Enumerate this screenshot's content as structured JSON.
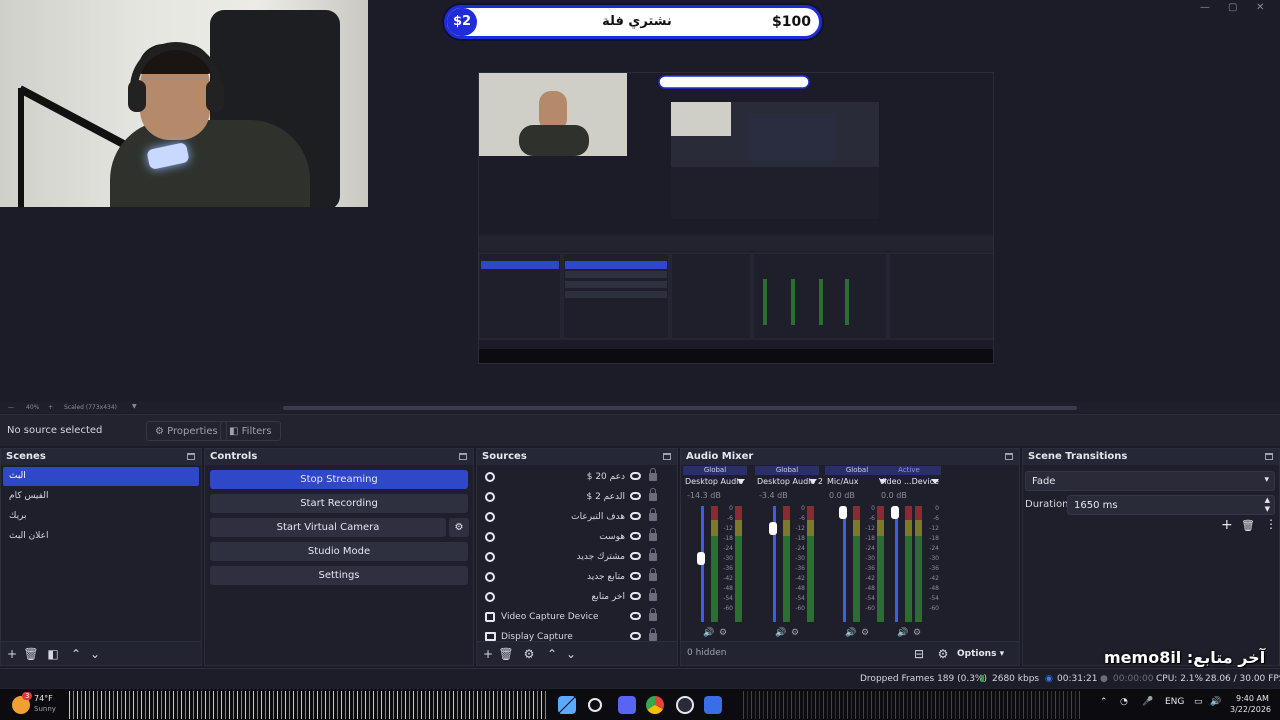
{
  "preview": {
    "donation": {
      "count": "$2",
      "title": "نشتري فلة",
      "goal": "$100"
    },
    "zoom": "40%",
    "scale_mode": "Scaled (773x434)"
  },
  "source_toolbar": {
    "no_source": "No source selected",
    "properties": "Properties",
    "filters": "Filters"
  },
  "scenes": {
    "title": "Scenes",
    "items": [
      {
        "label": "البث",
        "active": true
      },
      {
        "label": "الفيس كام",
        "active": false
      },
      {
        "label": "بريك",
        "active": false
      },
      {
        "label": "اعلان البث",
        "active": false
      }
    ]
  },
  "controls": {
    "title": "Controls",
    "stop_streaming": "Stop Streaming",
    "start_recording": "Start Recording",
    "start_virtual_camera": "Start Virtual Camera",
    "studio_mode": "Studio Mode",
    "settings": "Settings"
  },
  "sources": {
    "title": "Sources",
    "items": [
      {
        "label": "دعم 20 $",
        "icon": "globe-icon",
        "rtl": true
      },
      {
        "label": "الدعم 2 $",
        "icon": "globe-icon",
        "rtl": true
      },
      {
        "label": "هدف التبرعات",
        "icon": "globe-icon",
        "rtl": true
      },
      {
        "label": "هوست",
        "icon": "globe-icon",
        "rtl": true
      },
      {
        "label": "مشترك جديد",
        "icon": "globe-icon",
        "rtl": true
      },
      {
        "label": "متابع جديد",
        "icon": "globe-icon",
        "rtl": true
      },
      {
        "label": "اخر متابع",
        "icon": "globe-icon",
        "rtl": true
      },
      {
        "label": "Video Capture Device",
        "icon": "camera-icon",
        "rtl": false
      },
      {
        "label": "Display Capture",
        "icon": "monitor-icon",
        "rtl": false
      }
    ]
  },
  "audio_mixer": {
    "title": "Audio Mixer",
    "hidden": "0 hidden",
    "options": "Options",
    "channels": [
      {
        "tag": "Global",
        "name": "Desktop Audio",
        "db": "-14.3 dB",
        "level": 0.46
      },
      {
        "tag": "Global",
        "name": "Desktop Audio 2",
        "db": "-3.4 dB",
        "level": 0.8
      },
      {
        "tag": "Global",
        "name": "Mic/Aux",
        "db": "0.0 dB",
        "level": 1.0
      },
      {
        "tag": "Active",
        "name": "Video ...Device",
        "db": "0.0 dB",
        "level": 1.0
      }
    ],
    "scale": [
      "0",
      "-6",
      "-12",
      "-18",
      "-24",
      "-30",
      "-36",
      "-42",
      "-48",
      "-54",
      "-60"
    ]
  },
  "scene_transitions": {
    "title": "Scene Transitions",
    "transition": "Fade",
    "duration_label": "Duration",
    "duration_value": "1650 ms"
  },
  "status": {
    "dropped": "Dropped Frames 189 (0.3%)",
    "kbps": "2680 kbps",
    "stream_time": "00:31:21",
    "rec_time": "00:00:00",
    "cpu": "CPU: 2.1%",
    "fps": "28.06 / 30.00 FPS"
  },
  "overlay": {
    "last_follower": "memo8il :آخر متابع"
  },
  "taskbar": {
    "weather_temp": "74°F",
    "weather_cond": "Sunny",
    "lang": "ENG",
    "time": "9:40 AM",
    "date": "3/22/2026",
    "badge": "3"
  },
  "colors": {
    "accent": "#2f48c8",
    "bg": "#1e1f2a"
  }
}
